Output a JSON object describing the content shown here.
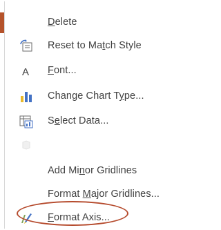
{
  "context_menu": {
    "items": [
      {
        "name": "delete",
        "label": "Delete",
        "underline_index": 0,
        "enabled": true,
        "icon": "none"
      },
      {
        "name": "reset-to-match-style",
        "label": "Reset to Match Style",
        "underline_index": 11,
        "enabled": true,
        "icon": "reset-style-icon"
      },
      {
        "name": "font",
        "label": "Font...",
        "underline_index": 0,
        "enabled": true,
        "icon": "font-icon"
      },
      {
        "name": "change-chart-type",
        "label": "Change Chart Type...",
        "underline_index": 14,
        "enabled": true,
        "icon": "chart-type-icon"
      },
      {
        "name": "select-data",
        "label": "Select Data...",
        "underline_index": 1,
        "enabled": true,
        "icon": "select-data-icon"
      },
      {
        "name": "three-d-rotation",
        "label": "",
        "underline_index": -1,
        "enabled": false,
        "icon": "3d-rotation-icon"
      },
      {
        "name": "add-minor-gridlines",
        "label": "Add Minor Gridlines",
        "underline_index": 6,
        "enabled": true,
        "icon": "none"
      },
      {
        "name": "format-major-gridlines",
        "label": "Format Major Gridlines...",
        "underline_index": 7,
        "enabled": true,
        "icon": "none"
      },
      {
        "name": "format-axis",
        "label": "Format Axis...",
        "underline_index": 0,
        "enabled": true,
        "icon": "format-axis-icon"
      }
    ]
  },
  "colors": {
    "accent": "#b54a2c",
    "chart_blue": "#4472c4",
    "chart_yellow": "#e8b92b",
    "text": "#404040"
  }
}
